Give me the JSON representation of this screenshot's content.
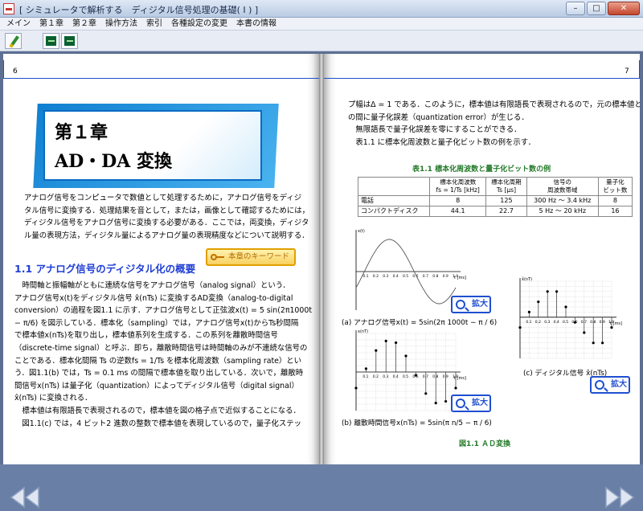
{
  "window": {
    "title": "[ シミュレータで解析する　ディジタル信号処理の基礎( I ) ]"
  },
  "menu": [
    "メイン",
    "第１章",
    "第２章",
    "操作方法",
    "索引",
    "各種設定の変更",
    "本書の情報"
  ],
  "toolbar": {
    "buttons": [
      "pen-icon",
      "chip-icon",
      "chip-icon"
    ]
  },
  "left_page": {
    "page_number": "6",
    "chapter_number": "第１章",
    "chapter_title": "AD・DA 変換",
    "intro": [
      "アナログ信号をコンピュータで数値として処理するために，アナログ信号をディジ",
      "タル信号に変換する．処理結果を音として，または，画像として確認するためには，",
      "ディジタル信号をアナログ信号に変換する必要がある．ここでは，両変換，ディジタ",
      "ル量の表現方法，ディジタル量によるアナログ量の表現精度などについて説明する．"
    ],
    "keyword_button": "本章のキーワード",
    "section_heading": "1.1 アナログ信号のディジタル化の概要",
    "body": [
      "　時間軸と振幅軸がともに連続な信号をアナログ信号（analog signal）という．",
      "アナログ信号x(t)をディジタル信号 x̂(nTs) に変換するAD変換（analog-to-digital",
      "conversion）の過程を図1.1 に示す．アナログ信号として正弦波x(t) = 5 sin(2π1000t",
      "− π/6) を図示している．標本化（sampling）では，アナログ信号x(t)からTs秒間隔",
      "で標本値x(nTs)を取り出し，標本値系列を生成する．この系列を離散時間信号",
      "（discrete-time signal）と呼ぶ．即ち，離散時間信号は時間軸のみが不連続な信号の",
      "ことである．標本化間隔 Ts の逆数fs = 1/Ts を標本化周波数（sampling rate）とい",
      "う．図1.1(b) では，Ts = 0.1 ms の間隔で標本値を取り出している．次いで，離散時",
      "間信号x(nTs) は量子化（quantization）によってディジタル信号（digital signal）",
      "x̂(nTs) に変換される．",
      "　標本値は有限語長で表現されるので，標本値を図の格子点で近似することになる．",
      "　図1.1(c) では，4 ビット2 進数の整数で標本値を表現しているので，量子化ステッ"
    ]
  },
  "right_page": {
    "page_number": "7",
    "body": [
      "プ幅はΔ = 1 である．このように，標本値は有限語長で表現されるので，元の標本値と",
      "の間に量子化誤差（quantization error）が生じる．",
      "　無限語長で量子化誤差を零にすることができる．",
      "　表1.1 に標本化周波数と量子化ビット数の例を示す．"
    ],
    "table_caption": "表1.1  標本化周波数と量子化ビット数の例",
    "table": {
      "headers": [
        "",
        "標本化周波数\nfs = 1/Ts [kHz]",
        "標本化周期\nTs [μs]",
        "信号の\n周波数帯域",
        "量子化\nビット数"
      ],
      "rows": [
        [
          "電話",
          "8",
          "125",
          "300 Hz 〜 3.4 kHz",
          "8"
        ],
        [
          "コンパクトディスク",
          "44.1",
          "22.7",
          "5 Hz 〜 20 kHz",
          "16"
        ]
      ]
    },
    "zoom_label": "拡大",
    "captions": {
      "a": "(a) アナログ信号x(t) = 5sin(2π 1000t − π / 6)",
      "b": "(b) 離散時間信号x(nTs) = 5sin(π n/5 − π / 6)",
      "c": "(c) ディジタル信号 x̂(nTs)"
    },
    "figure_title": "図1.1  ＡＤ変換"
  },
  "colors": {
    "link": "#1f3fd6",
    "caption_green": "#237a28",
    "banner": "#0f7fd0",
    "keyword": "#f8d060"
  },
  "chart_data": [
    {
      "type": "line",
      "title": "(a) アナログ信号x(t) = 5sin(2π 1000t − π / 6)",
      "ylabel": "x(t)",
      "xlabel": "t [ms]",
      "x": [
        0,
        0.1,
        0.2,
        0.3,
        0.4,
        0.5,
        0.6,
        0.7,
        0.8,
        0.9,
        1.0
      ],
      "values": [
        -2.5,
        0.52,
        3.35,
        4.83,
        4.57,
        2.5,
        -0.52,
        -3.35,
        -4.83,
        -4.57,
        -2.5
      ],
      "ylim": [
        -6,
        6
      ]
    },
    {
      "type": "scatter",
      "title": "(b) 離散時間信号x(nTs) = 5sin(π n/5 − π / 6)",
      "ylabel": "x(nT)",
      "xlabel": "t [ms]",
      "x": [
        0,
        0.1,
        0.2,
        0.3,
        0.4,
        0.5,
        0.6,
        0.7,
        0.8,
        0.9,
        1.0
      ],
      "values": [
        -2.5,
        0.52,
        3.35,
        4.83,
        4.57,
        2.5,
        -0.52,
        -3.35,
        -4.83,
        -4.57,
        -2.5
      ],
      "ylim": [
        -6,
        6
      ]
    },
    {
      "type": "scatter",
      "title": "(c) ディジタル信号 x̂(nTs)",
      "ylabel": "x̂(nT)",
      "xlabel": "t [ms]",
      "x": [
        0,
        0.1,
        0.2,
        0.3,
        0.4,
        0.5,
        0.6,
        0.7,
        0.8,
        0.9,
        1.0
      ],
      "values": [
        -2,
        1,
        3,
        5,
        5,
        2,
        -1,
        -3,
        -5,
        -5,
        -2
      ],
      "ylim": [
        -8,
        7
      ]
    }
  ]
}
